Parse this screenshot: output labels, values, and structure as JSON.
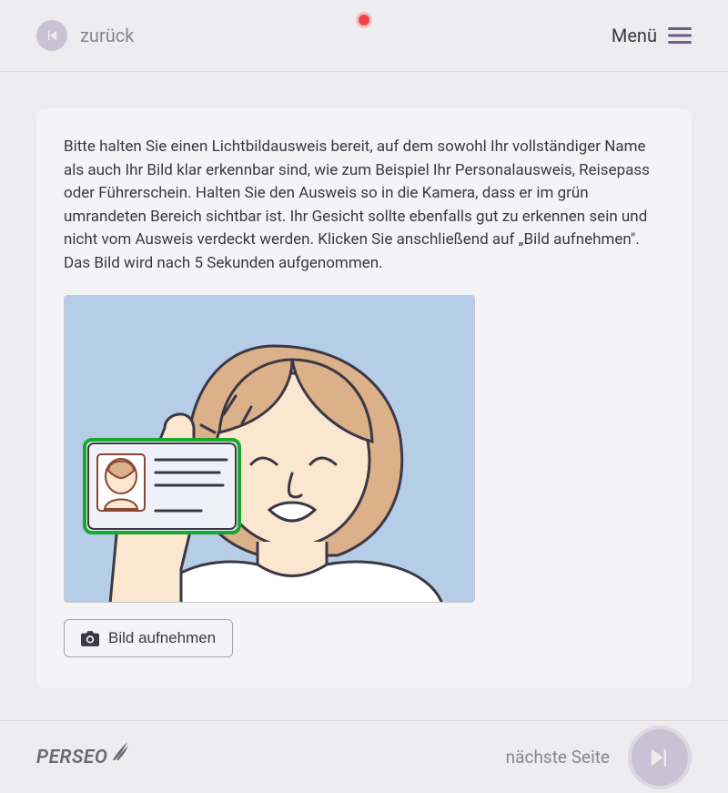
{
  "header": {
    "back_label": "zurück",
    "menu_label": "Menü"
  },
  "main": {
    "instructions": "Bitte halten Sie einen Lichtbildausweis bereit, auf dem sowohl Ihr vollständiger Name als auch Ihr Bild klar erkennbar sind, wie zum Beispiel Ihr Personalausweis, Reisepass oder Führerschein. Halten Sie den Ausweis so in die Kamera, dass er im grün umrandeten Bereich sichtbar ist. Ihr Gesicht sollte ebenfalls gut zu erkennen sein und nicht vom Ausweis verdeckt werden. Klicken Sie anschließend auf „Bild aufnehmen\". Das Bild wird nach 5 Sekunden aufgenommen.",
    "capture_button": "Bild aufnehmen"
  },
  "footer": {
    "logo_text": "PERSEO",
    "next_label": "nächste Seite"
  }
}
